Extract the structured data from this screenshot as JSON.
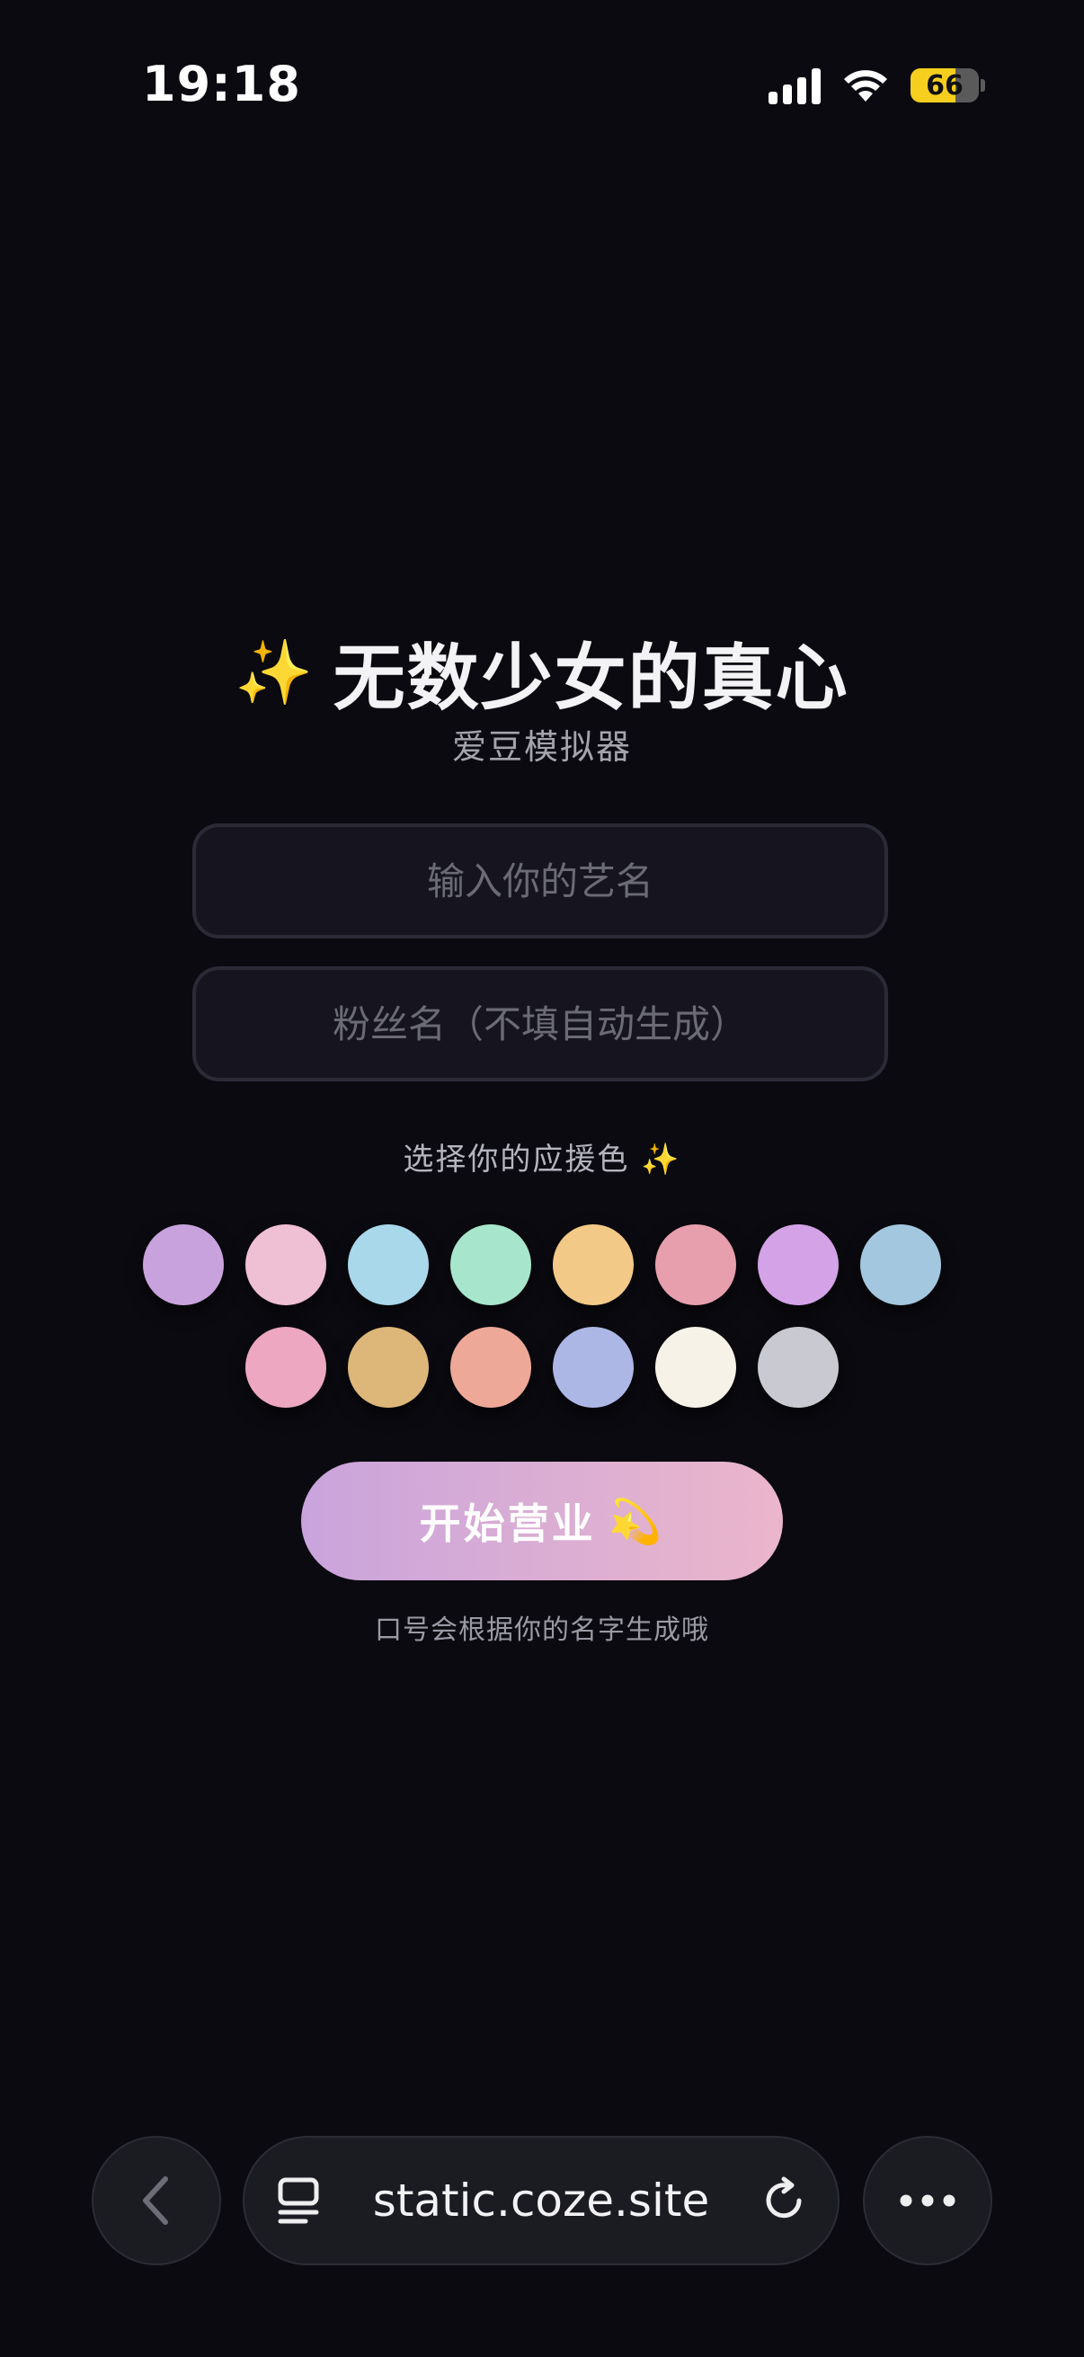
{
  "status": {
    "time": "19:18",
    "battery": "66",
    "battery_level": 0.66
  },
  "header": {
    "sparkle": "✨",
    "title": "无数少女的真心",
    "subtitle": "爱豆模拟器"
  },
  "form": {
    "name_placeholder": "输入你的艺名",
    "fan_placeholder": "粉丝名（不填自动生成）",
    "name_value": "",
    "fan_value": ""
  },
  "colors": {
    "label": "选择你的应援色",
    "label_sparkle": "✨",
    "swatches_row1": [
      "#c8a2dc",
      "#efbfd4",
      "#a9d8ea",
      "#a7e6cc",
      "#f3c987",
      "#e79ead",
      "#d4a2e7",
      "#a3c7de"
    ],
    "swatches_row2": [
      "#eda7c1",
      "#ddb77a",
      "#eea898",
      "#adb7e6",
      "#f7f2e7",
      "#c9c9d1"
    ]
  },
  "start": {
    "label": "开始营业",
    "emoji": "💫"
  },
  "hint": "口号会根据你的名字生成哦",
  "browser": {
    "url": "static.coze.site"
  },
  "icons": [
    "chevron-left-icon",
    "tabs-icon",
    "reload-icon",
    "more-icon",
    "wifi-icon",
    "signal-icon",
    "battery-icon"
  ]
}
